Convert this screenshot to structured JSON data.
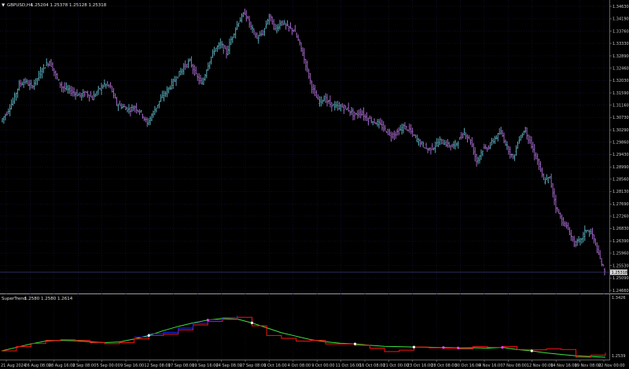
{
  "chart_header": {
    "menu_icon": "triangle-down-icon",
    "symbol": "GBPUSD,H4",
    "ohlc": "1.25204 1.25378 1.25128 1.25318"
  },
  "indicator_header": {
    "name": "SuperTrend",
    "values": "1.2580 1.2580 1.2614"
  },
  "colors": {
    "background": "#000000",
    "grid": "#1b1b4a",
    "bull_bar": "#5fb8c8",
    "bear_bar": "#b070d8",
    "axis_text": "#c8c8c8",
    "price_line": "#5a5ab8",
    "supertrend_up": "#1e28ff",
    "supertrend_down": "#ff1010",
    "ma_line": "#3fe03f",
    "signal_dot": "#ffffff",
    "signal_dot_magenta": "#ff44ff"
  },
  "price_axis_labels": [
    "1.34630",
    "1.34190",
    "1.33760",
    "1.33330",
    "1.32890",
    "1.32460",
    "1.32030",
    "1.31590",
    "1.31160",
    "1.30730",
    "1.30290",
    "1.29860",
    "1.29430",
    "1.28990",
    "1.28560",
    "1.28130",
    "1.27690",
    "1.27260",
    "1.26830",
    "1.26390",
    "1.25960",
    "1.25530",
    "1.25090",
    "1.24660"
  ],
  "current_price_tag": "1.25318",
  "indicator_axis_labels": [
    "1.3426",
    "1.2539"
  ],
  "time_axis_labels": [
    "21 Aug 2024",
    "26 Aug 08:00",
    "28 Aug 16:00",
    "2 Sep 08:00",
    "5 Sep 00:00",
    "9 Sep 16:00",
    "12 Sep 08:00",
    "17 Sep 08:00",
    "19 Sep 16:00",
    "24 Sep 08:00",
    "27 Sep 08:00",
    "1 Oct 16:00",
    "4 Oct 08:00",
    "9 Oct 00:00",
    "11 Oct 16:00",
    "16 Oct 08:00",
    "21 Oct 00:00",
    "23 Oct 16:00",
    "28 Oct 08:00",
    "30 Oct 16:00",
    "4 Nov 16:00",
    "7 Nov 08:00",
    "12 Nov 00:00",
    "14 Nov 16:00",
    "19 Nov 08:00",
    "22 Nov 00:00"
  ],
  "chart_data": {
    "type": "line",
    "price_range": [
      1.2466,
      1.3463
    ],
    "indicator_range": [
      1.2539,
      1.3426
    ],
    "close_series": [
      1.306,
      1.309,
      1.313,
      1.319,
      1.32,
      1.318,
      1.321,
      1.325,
      1.327,
      1.322,
      1.318,
      1.317,
      1.316,
      1.315,
      1.316,
      1.314,
      1.317,
      1.319,
      1.318,
      1.312,
      1.311,
      1.31,
      1.311,
      1.309,
      1.305,
      1.309,
      1.313,
      1.316,
      1.319,
      1.322,
      1.325,
      1.327,
      1.322,
      1.319,
      1.326,
      1.331,
      1.333,
      1.33,
      1.336,
      1.341,
      1.344,
      1.339,
      1.335,
      1.337,
      1.343,
      1.338,
      1.341,
      1.339,
      1.338,
      1.333,
      1.326,
      1.318,
      1.313,
      1.314,
      1.312,
      1.311,
      1.311,
      1.31,
      1.308,
      1.309,
      1.307,
      1.306,
      1.305,
      1.303,
      1.301,
      1.302,
      1.304,
      1.303,
      1.3,
      1.298,
      1.296,
      1.297,
      1.299,
      1.298,
      1.297,
      1.299,
      1.302,
      1.299,
      1.292,
      1.296,
      1.297,
      1.3,
      1.302,
      1.297,
      1.293,
      1.3,
      1.303,
      1.297,
      1.292,
      1.285,
      1.286,
      1.276,
      1.271,
      1.268,
      1.263,
      1.264,
      1.268,
      1.266,
      1.259,
      1.253
    ],
    "supertrend_series": [
      1.264,
      1.27,
      1.2745,
      1.279,
      1.28,
      1.279,
      1.276,
      1.2742,
      1.276,
      1.2812,
      1.286,
      1.288,
      1.294,
      1.301,
      1.306,
      1.309,
      1.312,
      1.3,
      1.286,
      1.282,
      1.278,
      1.279,
      1.274,
      1.274,
      1.272,
      1.268,
      1.263,
      1.265,
      1.2695,
      1.2685,
      1.268,
      1.267,
      1.27,
      1.269,
      1.27,
      1.266,
      1.2655,
      1.267,
      1.266,
      1.255,
      1.258,
      1.2614
    ],
    "ma_series": [
      1.264,
      1.269,
      1.274,
      1.278,
      1.279,
      1.2785,
      1.277,
      1.2758,
      1.2768,
      1.281,
      1.286,
      1.293,
      1.299,
      1.304,
      1.308,
      1.3105,
      1.3095,
      1.304,
      1.297,
      1.29,
      1.285,
      1.28,
      1.277,
      1.275,
      1.274,
      1.272,
      1.2705,
      1.27,
      1.2695,
      1.2692,
      1.2688,
      1.2682,
      1.2685,
      1.268,
      1.269,
      1.266,
      1.264,
      1.261,
      1.259,
      1.257,
      1.256,
      1.255
    ],
    "signal_points": [
      {
        "i": 10,
        "color": "white"
      },
      {
        "i": 14,
        "color": "magenta"
      },
      {
        "i": 17,
        "color": "white"
      },
      {
        "i": 24,
        "color": "white"
      },
      {
        "i": 28,
        "color": "white"
      },
      {
        "i": 30,
        "color": "magenta"
      },
      {
        "i": 31,
        "color": "magenta"
      },
      {
        "i": 34,
        "color": "magenta"
      },
      {
        "i": 36,
        "color": "white"
      }
    ]
  }
}
